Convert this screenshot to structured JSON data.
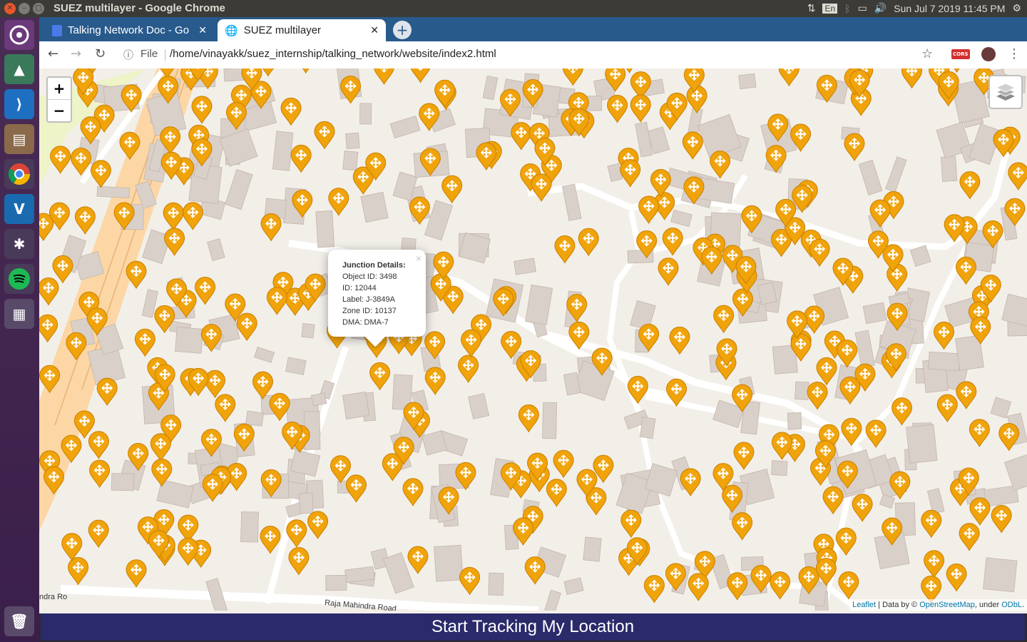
{
  "window": {
    "title": "SUEZ multilayer - Google Chrome"
  },
  "system": {
    "datetime": "Sun Jul 7 2019 11:45 PM",
    "lang": "En"
  },
  "tabs": [
    {
      "label": "Talking Network Doc - Go"
    },
    {
      "label": "SUEZ multilayer"
    }
  ],
  "address": {
    "scheme_label": "File",
    "url": "/home/vinayakk/suez_internship/talking_network/website/index2.html"
  },
  "extension": {
    "label": "CORS"
  },
  "map": {
    "zoom_in": "+",
    "zoom_out": "−",
    "road_label": "Raja Mahindra Road",
    "road_label_left": "ndra Ro",
    "marker_color": "#f0a30a",
    "popup": {
      "title": "Junction Details:",
      "lines": [
        "Object ID: 3498",
        "ID: 12044",
        "Label: J-3849A",
        "Zone ID: 10137",
        "DMA: DMA-7"
      ],
      "close": "×"
    },
    "attribution": {
      "leaflet": "Leaflet",
      "sep": " | Data by © ",
      "osm": "OpenStreetMap",
      "under": ", under ",
      "odbl": "ODbL",
      "end": "."
    }
  },
  "track_button": {
    "label": "Start Tracking My Location"
  }
}
